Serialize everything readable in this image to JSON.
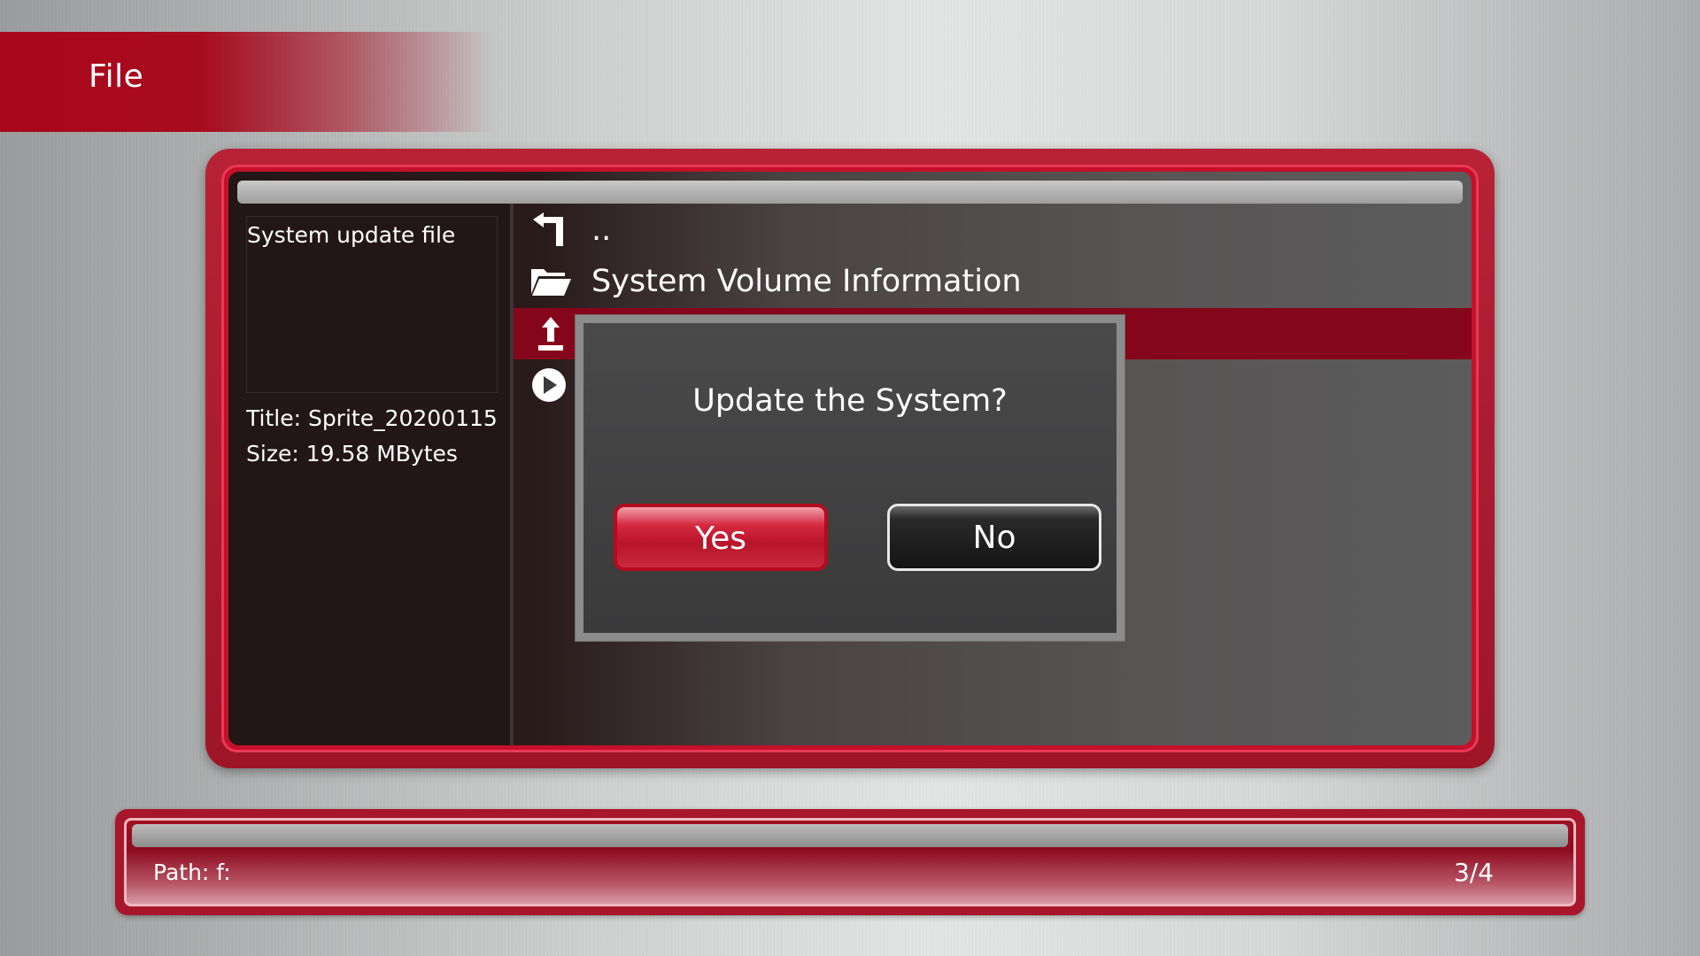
{
  "header": {
    "title": "File"
  },
  "info": {
    "preview_caption": "System update file",
    "title_line": "Title: Sprite_20200115",
    "size_line": "Size: 19.58 MBytes"
  },
  "file_list": [
    {
      "label": "..",
      "icon": "parent-folder-arrow-icon"
    },
    {
      "label": "System Volume Information",
      "icon": "folder-icon"
    },
    {
      "label": "",
      "icon": "update-file-icon",
      "selected": true
    },
    {
      "label": "",
      "icon": "play-icon"
    }
  ],
  "dialog": {
    "question": "Update the System?",
    "yes_label": "Yes",
    "no_label": "No"
  },
  "status": {
    "path": "Path: f:",
    "count": "3/4"
  },
  "colors": {
    "accent_red": "#a8081c",
    "selection_red": "#85061a",
    "dialog_bg": "#434344"
  }
}
